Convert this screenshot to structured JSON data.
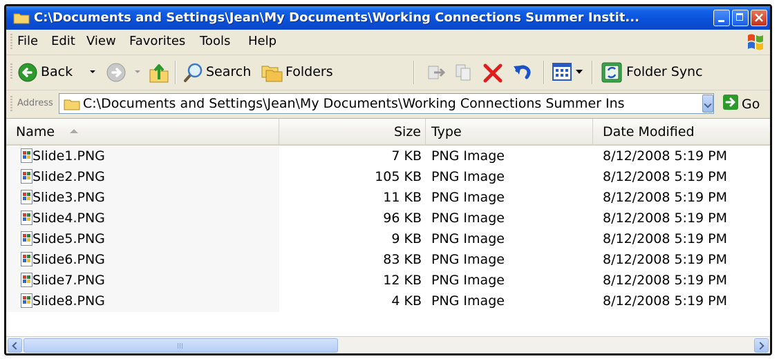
{
  "window": {
    "title": "C:\\Documents and Settings\\Jean\\My Documents\\Working Connections Summer Instit..."
  },
  "menu": {
    "items": [
      "File",
      "Edit",
      "View",
      "Favorites",
      "Tools",
      "Help"
    ]
  },
  "toolbar": {
    "back_label": "Back",
    "search_label": "Search",
    "folders_label": "Folders",
    "folder_sync_label": "Folder Sync"
  },
  "address": {
    "label": "Address",
    "value": "C:\\Documents and Settings\\Jean\\My Documents\\Working Connections Summer Ins",
    "go_label": "Go"
  },
  "columns": {
    "name": "Name",
    "size": "Size",
    "type": "Type",
    "date": "Date Modified"
  },
  "files": [
    {
      "name": "Slide1.PNG",
      "size": "7 KB",
      "type": "PNG Image",
      "date": "8/12/2008 5:19 PM"
    },
    {
      "name": "Slide2.PNG",
      "size": "105 KB",
      "type": "PNG Image",
      "date": "8/12/2008 5:19 PM"
    },
    {
      "name": "Slide3.PNG",
      "size": "11 KB",
      "type": "PNG Image",
      "date": "8/12/2008 5:19 PM"
    },
    {
      "name": "Slide4.PNG",
      "size": "96 KB",
      "type": "PNG Image",
      "date": "8/12/2008 5:19 PM"
    },
    {
      "name": "Slide5.PNG",
      "size": "9 KB",
      "type": "PNG Image",
      "date": "8/12/2008 5:19 PM"
    },
    {
      "name": "Slide6.PNG",
      "size": "83 KB",
      "type": "PNG Image",
      "date": "8/12/2008 5:19 PM"
    },
    {
      "name": "Slide7.PNG",
      "size": "12 KB",
      "type": "PNG Image",
      "date": "8/12/2008 5:19 PM"
    },
    {
      "name": "Slide8.PNG",
      "size": "4 KB",
      "type": "PNG Image",
      "date": "8/12/2008 5:19 PM"
    }
  ],
  "icons": {
    "title": "folder-icon",
    "back": "back-arrow-icon",
    "forward": "forward-arrow-icon",
    "up": "up-folder-icon",
    "search": "magnifier-icon",
    "folders": "folders-icon",
    "move": "move-to-icon",
    "copy": "copy-to-icon",
    "delete": "delete-x-icon",
    "undo": "undo-icon",
    "views": "views-icon",
    "sync": "folder-sync-icon",
    "file": "png-image-icon"
  },
  "colors": {
    "title_bar": "#0a50d8",
    "chrome": "#ece9d8",
    "delete": "#e41b1b",
    "go": "#2b9a2b"
  }
}
